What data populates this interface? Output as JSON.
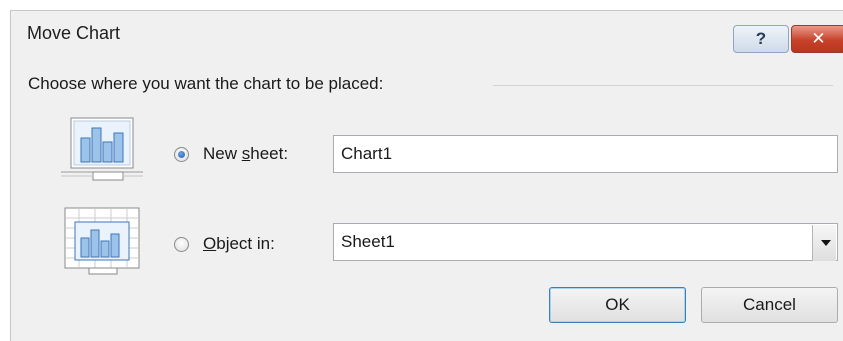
{
  "dialog": {
    "title": "Move Chart",
    "help_label": "?",
    "close_label": "✕",
    "prompt": "Choose where you want the chart to be placed:"
  },
  "options": {
    "new_sheet": {
      "label_pre": "New ",
      "label_accel": "s",
      "label_post": "heet:",
      "value": "Chart1",
      "selected": true
    },
    "object_in": {
      "label_pre": "",
      "label_accel": "O",
      "label_post": "bject in:",
      "value": "Sheet1",
      "selected": false
    }
  },
  "buttons": {
    "ok": "OK",
    "cancel": "Cancel"
  },
  "icons": {
    "new_sheet": "chart-sheet-icon",
    "object_in": "embedded-chart-icon"
  },
  "colors": {
    "accent": "#3c7fb1",
    "close": "#c8422a"
  }
}
